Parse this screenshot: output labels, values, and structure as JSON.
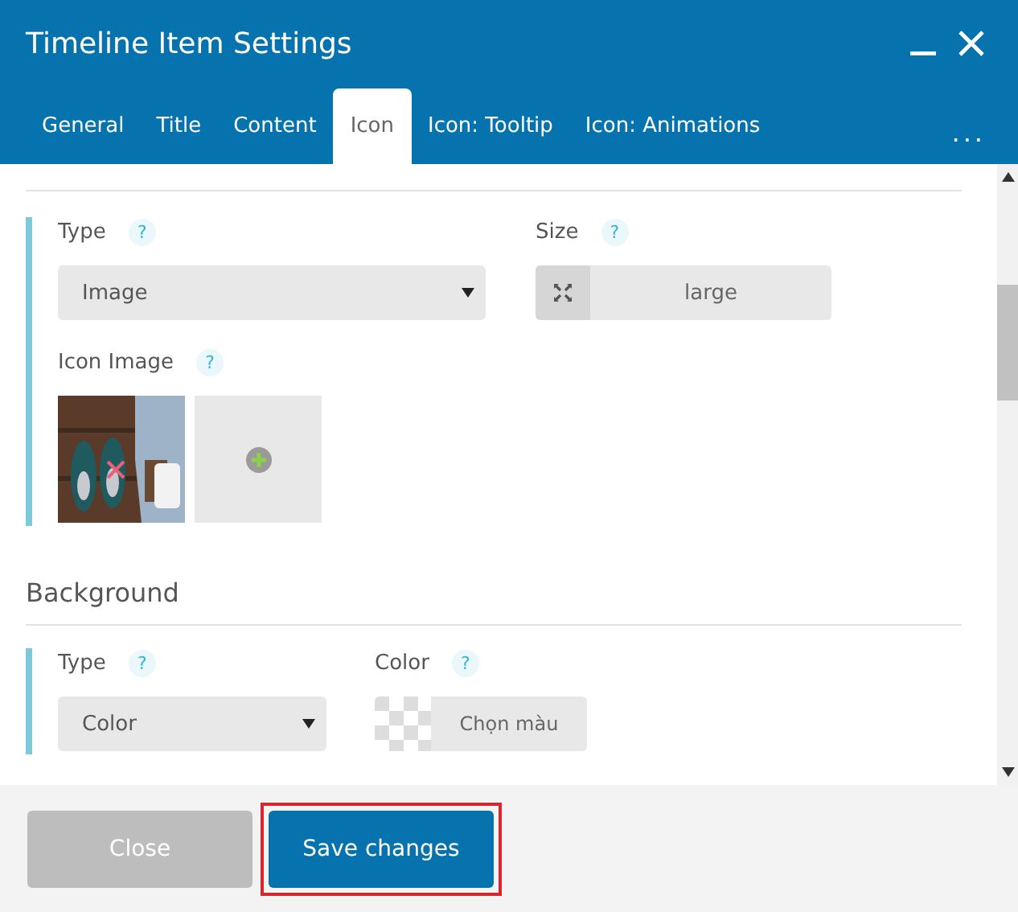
{
  "window": {
    "title": "Timeline Item Settings"
  },
  "tabs": [
    {
      "label": "General",
      "selected": false
    },
    {
      "label": "Title",
      "selected": false
    },
    {
      "label": "Content",
      "selected": false
    },
    {
      "label": "Icon",
      "selected": true
    },
    {
      "label": "Icon: Tooltip",
      "selected": false
    },
    {
      "label": "Icon: Animations",
      "selected": false
    }
  ],
  "more_tabs": "...",
  "icon_section": {
    "type": {
      "label": "Type",
      "help": "?",
      "value": "Image"
    },
    "size": {
      "label": "Size",
      "help": "?",
      "value": "large"
    },
    "icon_image": {
      "label": "Icon Image",
      "help": "?",
      "has_image": true
    }
  },
  "background_section": {
    "heading": "Background",
    "type": {
      "label": "Type",
      "help": "?",
      "value": "Color"
    },
    "color": {
      "label": "Color",
      "help": "?",
      "value": "Chọn màu"
    }
  },
  "buttons": [
    {
      "label": "Close",
      "kind": "secondary",
      "highlighted": false
    },
    {
      "label": "Save changes",
      "kind": "primary",
      "highlighted": true
    }
  ]
}
